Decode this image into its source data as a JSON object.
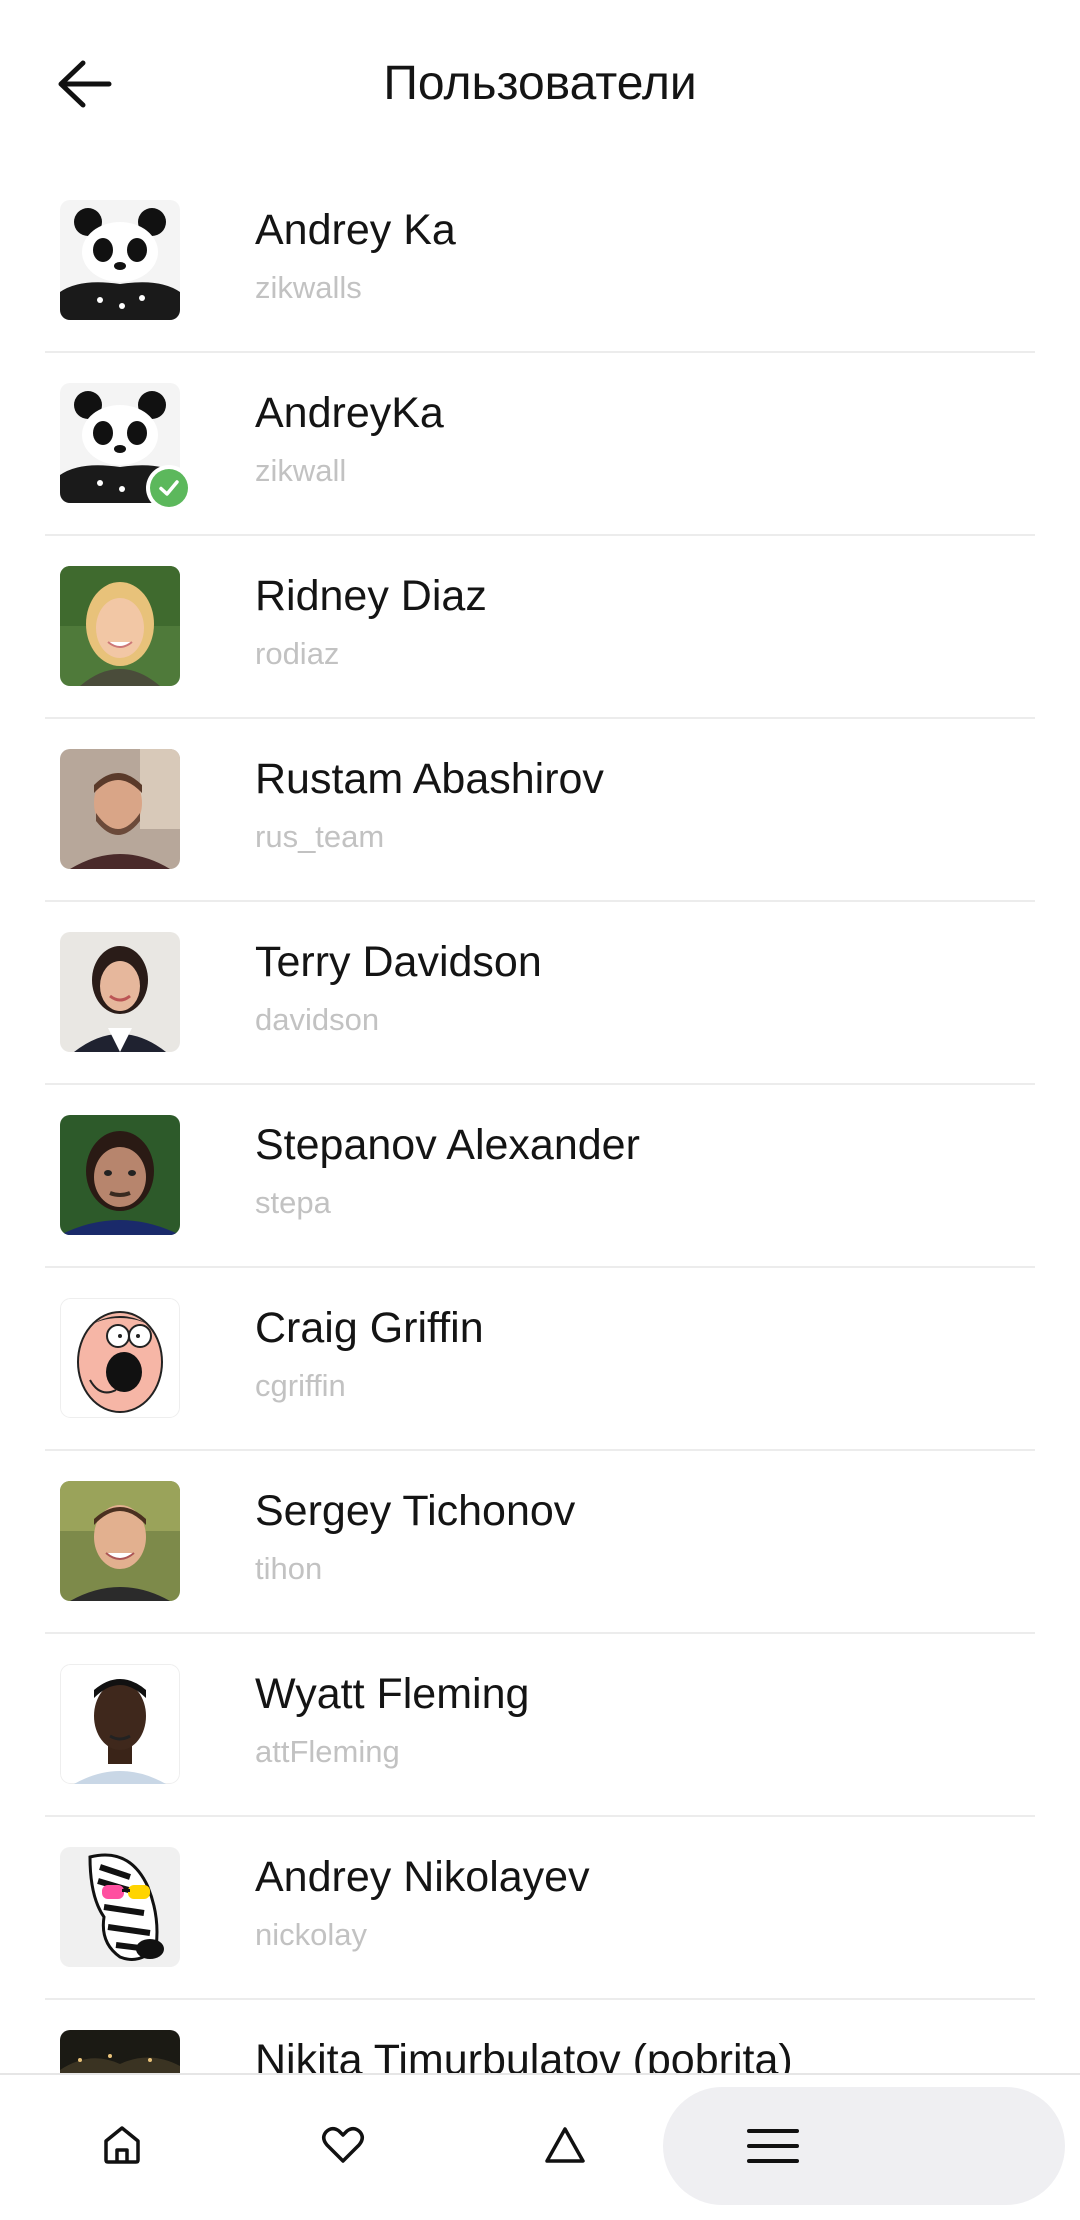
{
  "header": {
    "title": "Пользователи",
    "back_icon": "arrow-left-icon"
  },
  "users": [
    {
      "name": "Andrey Ka",
      "username": "zikwalls",
      "avatar": "panda",
      "verified": false
    },
    {
      "name": "AndreyKa",
      "username": "zikwall",
      "avatar": "panda",
      "verified": true
    },
    {
      "name": "Ridney Diaz",
      "username": "rodiaz",
      "avatar": "photo-blonde-woman",
      "verified": false
    },
    {
      "name": "Rustam Abashirov",
      "username": "rus_team",
      "avatar": "photo-bearded-man",
      "verified": false
    },
    {
      "name": "Terry Davidson",
      "username": "davidson",
      "avatar": "photo-dark-hair-woman",
      "verified": false
    },
    {
      "name": "Stepanov Alexander",
      "username": "stepa",
      "avatar": "photo-man-selfie",
      "verified": false
    },
    {
      "name": "Craig Griffin",
      "username": "cgriffin",
      "avatar": "cartoon-face",
      "verified": false
    },
    {
      "name": "Sergey Tichonov",
      "username": "tihon",
      "avatar": "photo-smiling-man",
      "verified": false
    },
    {
      "name": "Wyatt Fleming",
      "username": "attFleming",
      "avatar": "photo-man-portrait",
      "verified": false
    },
    {
      "name": "Andrey Nikolayev",
      "username": "nickolay",
      "avatar": "zebra-sunglasses",
      "verified": false
    },
    {
      "name": "Nikita Timurbulatov (pobrita)",
      "username": "",
      "avatar": "photo-dark-landscape",
      "verified": false
    }
  ],
  "bottom_nav": {
    "items": [
      {
        "icon": "home-icon",
        "active": false
      },
      {
        "icon": "heart-icon",
        "active": false
      },
      {
        "icon": "triangle-icon",
        "active": false
      },
      {
        "icon": "menu-icon",
        "active": true
      }
    ]
  },
  "colors": {
    "verified_badge": "#5cb85c",
    "username_text": "#c2c2c2",
    "active_nav_bg": "#efeff2"
  }
}
